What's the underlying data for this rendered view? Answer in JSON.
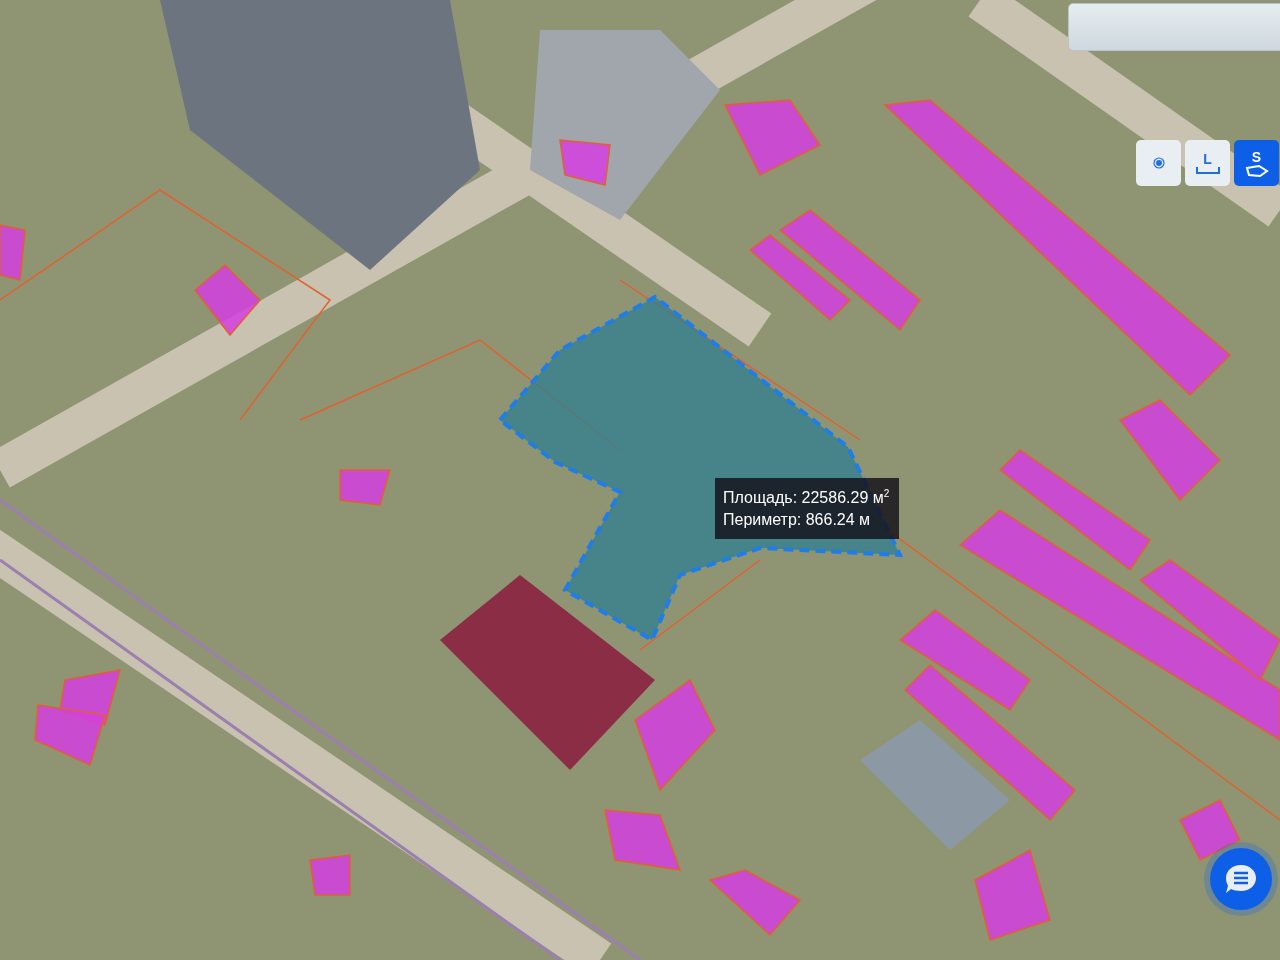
{
  "map": {
    "measurement": {
      "area": "Площадь: 22586.29 м$^{2}$",
      "perimeter": "Периметр: 866.24 м"
    }
  },
  "tools": [
    {
      "kind": "point",
      "selected": false
    },
    {
      "kind": "line",
      "label": "L",
      "selected": false
    },
    {
      "kind": "area",
      "label": "S",
      "selected": true
    }
  ]
}
